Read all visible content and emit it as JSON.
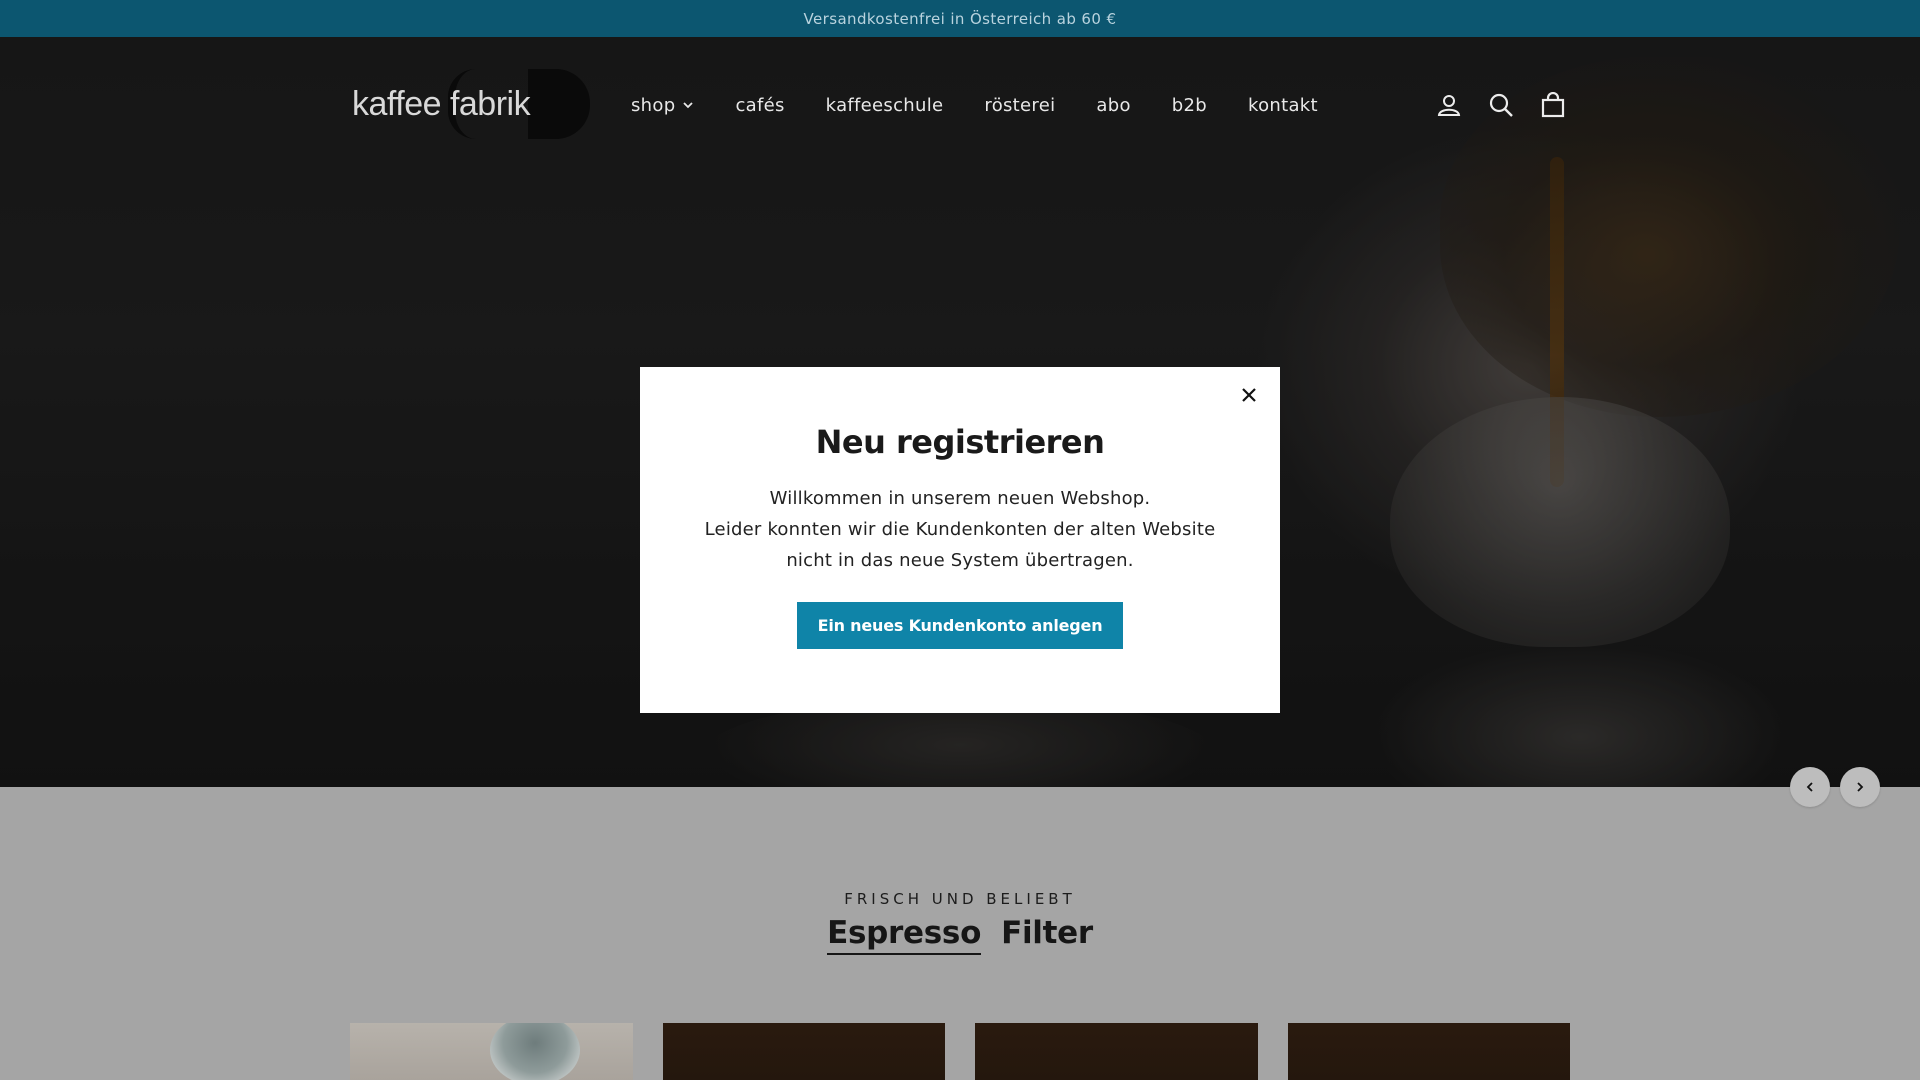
{
  "announcement": "Versandkostenfrei in Österreich ab 60 €",
  "logo": {
    "text": "kaffee fabrik"
  },
  "nav": {
    "items": [
      {
        "label": "shop",
        "has_dropdown": true
      },
      {
        "label": "cafés"
      },
      {
        "label": "kaffeeschule"
      },
      {
        "label": "rösterei"
      },
      {
        "label": "abo"
      },
      {
        "label": "b2b"
      },
      {
        "label": "kontakt"
      }
    ]
  },
  "header_icons": [
    "account-icon",
    "search-icon",
    "cart-icon"
  ],
  "modal": {
    "title": "Neu registrieren",
    "lines": [
      "Willkommen in unserem neuen Webshop.",
      "Leider konnten wir die Kundenkonten der alten Website",
      "nicht in das neue System übertragen."
    ],
    "cta_label": "Ein neues Kundenkonto anlegen"
  },
  "featured": {
    "eyebrow": "FRISCH UND BELIEBT",
    "tabs": [
      {
        "label": "Espresso",
        "active": true
      },
      {
        "label": "Filter",
        "active": false
      }
    ]
  },
  "colors": {
    "announcement_bg": "#0c5670",
    "cta_bg": "#0f84a8",
    "page_bg": "#a5a5a5"
  }
}
